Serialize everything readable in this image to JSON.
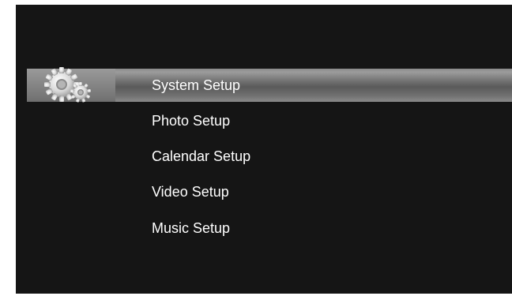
{
  "menu": {
    "selected_index": 0,
    "items": [
      {
        "label": "System Setup"
      },
      {
        "label": "Photo Setup"
      },
      {
        "label": "Calendar Setup"
      },
      {
        "label": "Video Setup"
      },
      {
        "label": "Music Setup"
      }
    ]
  },
  "icons": {
    "settings": "gears-icon"
  },
  "colors": {
    "background": "#151515",
    "highlight": "#6e6e6e",
    "text": "#ffffff"
  }
}
